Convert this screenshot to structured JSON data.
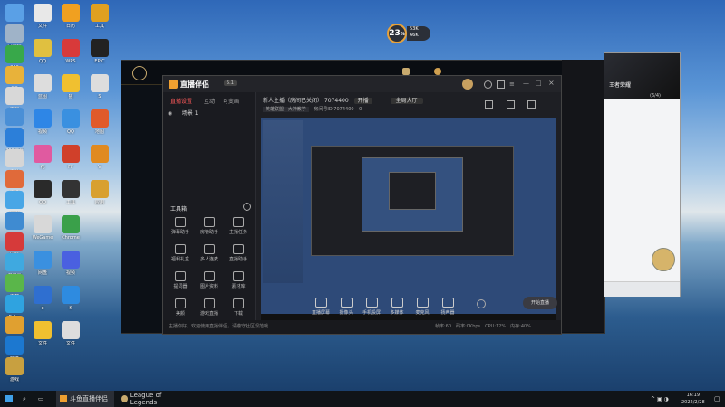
{
  "desktop": {
    "icons": [
      {
        "label": "此电脑",
        "color": "#5aa0e6"
      },
      {
        "label": "回收站",
        "color": "#9fb3c8"
      },
      {
        "label": "360",
        "color": "#38a84a"
      },
      {
        "label": "QQ",
        "color": "#e8b23a"
      },
      {
        "label": "文档",
        "color": "#d8d8d8"
      },
      {
        "label": "控制面板",
        "color": "#4a8fd6"
      },
      {
        "label": "360安全",
        "color": "#2c7fd9"
      },
      {
        "label": "工具",
        "color": "#d6d6d6"
      },
      {
        "label": "文件",
        "color": "#e06a3a"
      },
      {
        "label": "应用",
        "color": "#48a6e6"
      },
      {
        "label": "设置",
        "color": "#3f8bd1"
      },
      {
        "label": "网易",
        "color": "#d63a3a"
      },
      {
        "label": "浏览器",
        "color": "#3fa9e0"
      },
      {
        "label": "下载",
        "color": "#5ab64a"
      },
      {
        "label": "Edge",
        "color": "#2fa3e0"
      },
      {
        "label": "工具箱",
        "color": "#e0a030"
      },
      {
        "label": "软件",
        "color": "#1c78d0"
      },
      {
        "label": "游戏",
        "color": "#c8a040"
      }
    ],
    "col2_icons": [
      {
        "label": "文件",
        "color": "#e8e8e8"
      },
      {
        "label": "QQ",
        "color": "#e0c040"
      },
      {
        "label": "蓝图",
        "color": "#ddd"
      },
      {
        "label": "视频",
        "color": "#2e86e6"
      },
      {
        "label": "花",
        "color": "#e05aa0"
      },
      {
        "label": "QQ",
        "color": "#2a2a2a"
      },
      {
        "label": "WeGame",
        "color": "#d8d8d8"
      },
      {
        "label": "网盘",
        "color": "#3a90e0"
      },
      {
        "label": "e",
        "color": "#2f6fd0"
      },
      {
        "label": "文件",
        "color": "#f0c030"
      }
    ],
    "col3_icons": [
      {
        "label": "日历",
        "color": "#f0a020"
      },
      {
        "label": "WPS",
        "color": "#d83a3a"
      },
      {
        "label": "猫",
        "color": "#f0c030"
      },
      {
        "label": "QQ",
        "color": "#3a90e0"
      },
      {
        "label": "FF",
        "color": "#d0402a"
      },
      {
        "label": "工具",
        "color": "#333"
      },
      {
        "label": "Chrome",
        "color": "#3aa04a"
      },
      {
        "label": "视频",
        "color": "#4a60e0"
      },
      {
        "label": "K",
        "color": "#2e8be0"
      },
      {
        "label": "文件",
        "color": "#ddd"
      }
    ],
    "col4_icons": [
      {
        "label": "工具",
        "color": "#e0a020"
      },
      {
        "label": "EPIC",
        "color": "#222"
      },
      {
        "label": "S",
        "color": "#ddd"
      },
      {
        "label": "地图",
        "color": "#e05a2a"
      },
      {
        "label": "V",
        "color": "#e08a20"
      },
      {
        "label": "应用",
        "color": "#d8a030"
      }
    ]
  },
  "perf_widget": {
    "value": "23",
    "unit": "%",
    "up": "53K",
    "down": "66K"
  },
  "stream_app": {
    "logo": "直播伴侣",
    "version": "5.1",
    "side_tabs": [
      "直播设置",
      "互动",
      "可变画"
    ],
    "scene": "场景 1",
    "tools_title": "工具箱",
    "tools": [
      {
        "label": "弹幕助手"
      },
      {
        "label": "房管助手"
      },
      {
        "label": "主播任务"
      },
      {
        "label": "福利礼盒"
      },
      {
        "label": "多人连麦"
      },
      {
        "label": "直播助手"
      },
      {
        "label": "提词器"
      },
      {
        "label": "图片资料"
      },
      {
        "label": "素材库"
      },
      {
        "label": "美颜"
      },
      {
        "label": "游戏直播"
      },
      {
        "label": "下载"
      }
    ],
    "room_label": "新人主播（房间已关闭）",
    "room_id": "7074400",
    "status_btn": "开播",
    "category_label": "全局大厅",
    "tag1": "英雄联盟 · 大神教学",
    "tag2": "房间号ID 7074400",
    "tag3": "0",
    "controls": [
      {
        "label": "直播屏幕"
      },
      {
        "label": "摄像头"
      },
      {
        "label": "手机投屏"
      },
      {
        "label": "多媒体"
      },
      {
        "label": "麦克风"
      },
      {
        "label": "扬声器"
      }
    ],
    "start_live": "开始直播",
    "notice": "主播你好，欢迎使用直播伴侣，请遵守社区规范哦",
    "stats": [
      "帧率:60",
      "码率:0Kbps",
      "CPU:12%",
      "内存:40%"
    ]
  },
  "chat": {
    "user": "王者荣耀",
    "count": "(6/4)"
  },
  "taskbar": {
    "app1": "斗鱼直播伴侣",
    "app2": "League of Legends",
    "time": "16:19",
    "date": "2022/2/28"
  }
}
